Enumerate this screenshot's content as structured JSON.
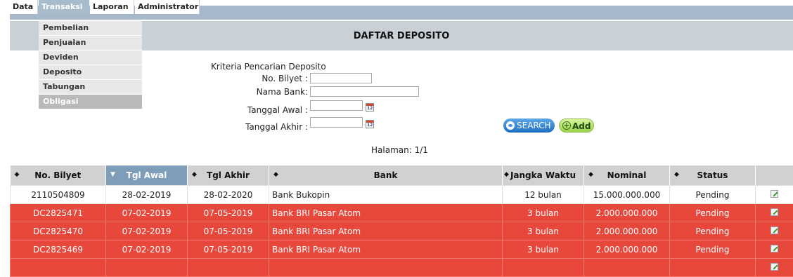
{
  "menu": {
    "items": [
      {
        "label": "Data",
        "active": false
      },
      {
        "label": "Transaksi",
        "active": true
      },
      {
        "label": "Laporan",
        "active": false
      },
      {
        "label": "Administrator",
        "active": false
      }
    ]
  },
  "dropdown": {
    "items": [
      {
        "label": "Pembelian",
        "active": false
      },
      {
        "label": "Penjualan",
        "active": false
      },
      {
        "label": "Deviden",
        "active": false
      },
      {
        "label": "Deposito",
        "active": false
      },
      {
        "label": "Tabungan",
        "active": false
      },
      {
        "label": "Obligasi",
        "active": true
      }
    ]
  },
  "header": {
    "title": "DAFTAR DEPOSITO"
  },
  "search": {
    "title": "Kriteria Pencarian Deposito",
    "no_bilyet_label": "No. Bilyet :",
    "no_bilyet_value": "",
    "nama_bank_label": "Nama Bank:",
    "nama_bank_value": "",
    "tanggal_awal_label": "Tanggal Awal :",
    "tanggal_awal_value": "",
    "tanggal_akhir_label": "Tanggal Akhir :",
    "tanggal_akhir_value": "",
    "calendar_icon_text": "12",
    "search_button_label": "SEARCH",
    "add_button_label": "Add",
    "add_icon_glyph": "+"
  },
  "pagination": {
    "label": "Halaman: 1/1"
  },
  "table": {
    "sorted_column": 1,
    "columns": [
      {
        "label": "No. Bilyet",
        "sort_glyph": "◆"
      },
      {
        "label": "Tgl Awal",
        "sort_glyph": "▼"
      },
      {
        "label": "Tgl Akhir",
        "sort_glyph": "◆"
      },
      {
        "label": "Bank",
        "sort_glyph": "◆"
      },
      {
        "label": "Jangka Waktu",
        "sort_glyph": "◆"
      },
      {
        "label": "Nominal",
        "sort_glyph": "◆"
      },
      {
        "label": "Status",
        "sort_glyph": "◆"
      },
      {
        "label": "",
        "sort_glyph": ""
      }
    ],
    "rows": [
      {
        "no_bilyet": "2110504809",
        "tgl_awal": "28-02-2019",
        "tgl_akhir": "28-02-2020",
        "bank": "Bank Bukopin",
        "jangka_waktu": "12 bulan",
        "nominal": "15.000.000.000",
        "status": "Pending",
        "highlight": false
      },
      {
        "no_bilyet": "DC2825471",
        "tgl_awal": "07-02-2019",
        "tgl_akhir": "07-05-2019",
        "bank": "Bank BRI Pasar Atom",
        "jangka_waktu": "3 bulan",
        "nominal": "2.000.000.000",
        "status": "Pending",
        "highlight": true
      },
      {
        "no_bilyet": "DC2825470",
        "tgl_awal": "07-02-2019",
        "tgl_akhir": "07-05-2019",
        "bank": "Bank BRI Pasar Atom",
        "jangka_waktu": "3 bulan",
        "nominal": "2.000.000.000",
        "status": "Pending",
        "highlight": true
      },
      {
        "no_bilyet": "DC2825469",
        "tgl_awal": "07-02-2019",
        "tgl_akhir": "07-05-2019",
        "bank": "Bank BRI Pasar Atom",
        "jangka_waktu": "3 bulan",
        "nominal": "2.000.000.000",
        "status": "Pending",
        "highlight": true
      },
      {
        "no_bilyet": "",
        "tgl_awal": "",
        "tgl_akhir": "",
        "bank": "",
        "jangka_waktu": "",
        "nominal": "",
        "status": "",
        "highlight": true
      }
    ]
  },
  "colors": {
    "menu_bar": "#a6b8c9",
    "header_band": "#c9d0d6",
    "row_highlight": "#e8473c",
    "sorted_header": "#7d9db8"
  },
  "icons": {
    "calendar": "calendar-icon",
    "edit": "edit-icon",
    "search": "search-icon",
    "add": "plus-circle-icon"
  }
}
